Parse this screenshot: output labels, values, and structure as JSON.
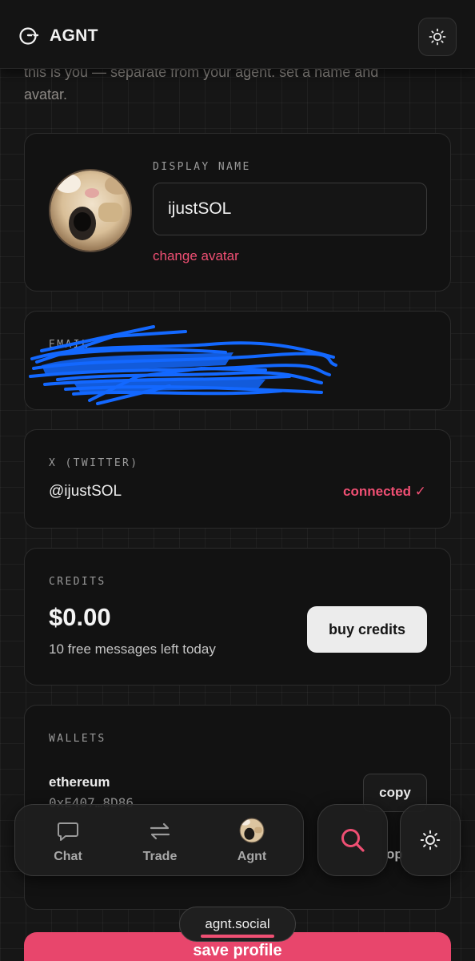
{
  "app": {
    "brand": "AGNT"
  },
  "intro": {
    "line1": "this is you — separate from your agent. set a name and",
    "line2": "avatar."
  },
  "profile": {
    "display_name_label": "DISPLAY NAME",
    "display_name_value": "ijustSOL",
    "change_avatar": "change avatar"
  },
  "email": {
    "label": "EMAIL",
    "value": ""
  },
  "twitter": {
    "label": "X (TWITTER)",
    "handle": "@ijustSOL",
    "status": "connected ✓"
  },
  "credits": {
    "label": "CREDITS",
    "balance": "$0.00",
    "note": "10 free messages left today",
    "buy_button": "buy credits"
  },
  "wallets": {
    "label": "WALLETS",
    "items": [
      {
        "chain": "ethereum",
        "address": "0xE407…8D86",
        "copy_label": "copy"
      }
    ],
    "partial_copy_label": "op"
  },
  "bottom_nav": {
    "items": [
      {
        "label": "Chat",
        "icon": "chat-bubble-icon"
      },
      {
        "label": "Trade",
        "icon": "swap-arrows-icon"
      },
      {
        "label": "Agnt",
        "icon": "avatar-icon"
      }
    ],
    "search_icon": "search-icon",
    "theme_icon": "sun-icon"
  },
  "domain": "agnt.social",
  "save_button": "save profile",
  "colors": {
    "accent": "#ef4f73",
    "background": "#161616",
    "card": "#121212",
    "scribble": "#1368ff"
  }
}
